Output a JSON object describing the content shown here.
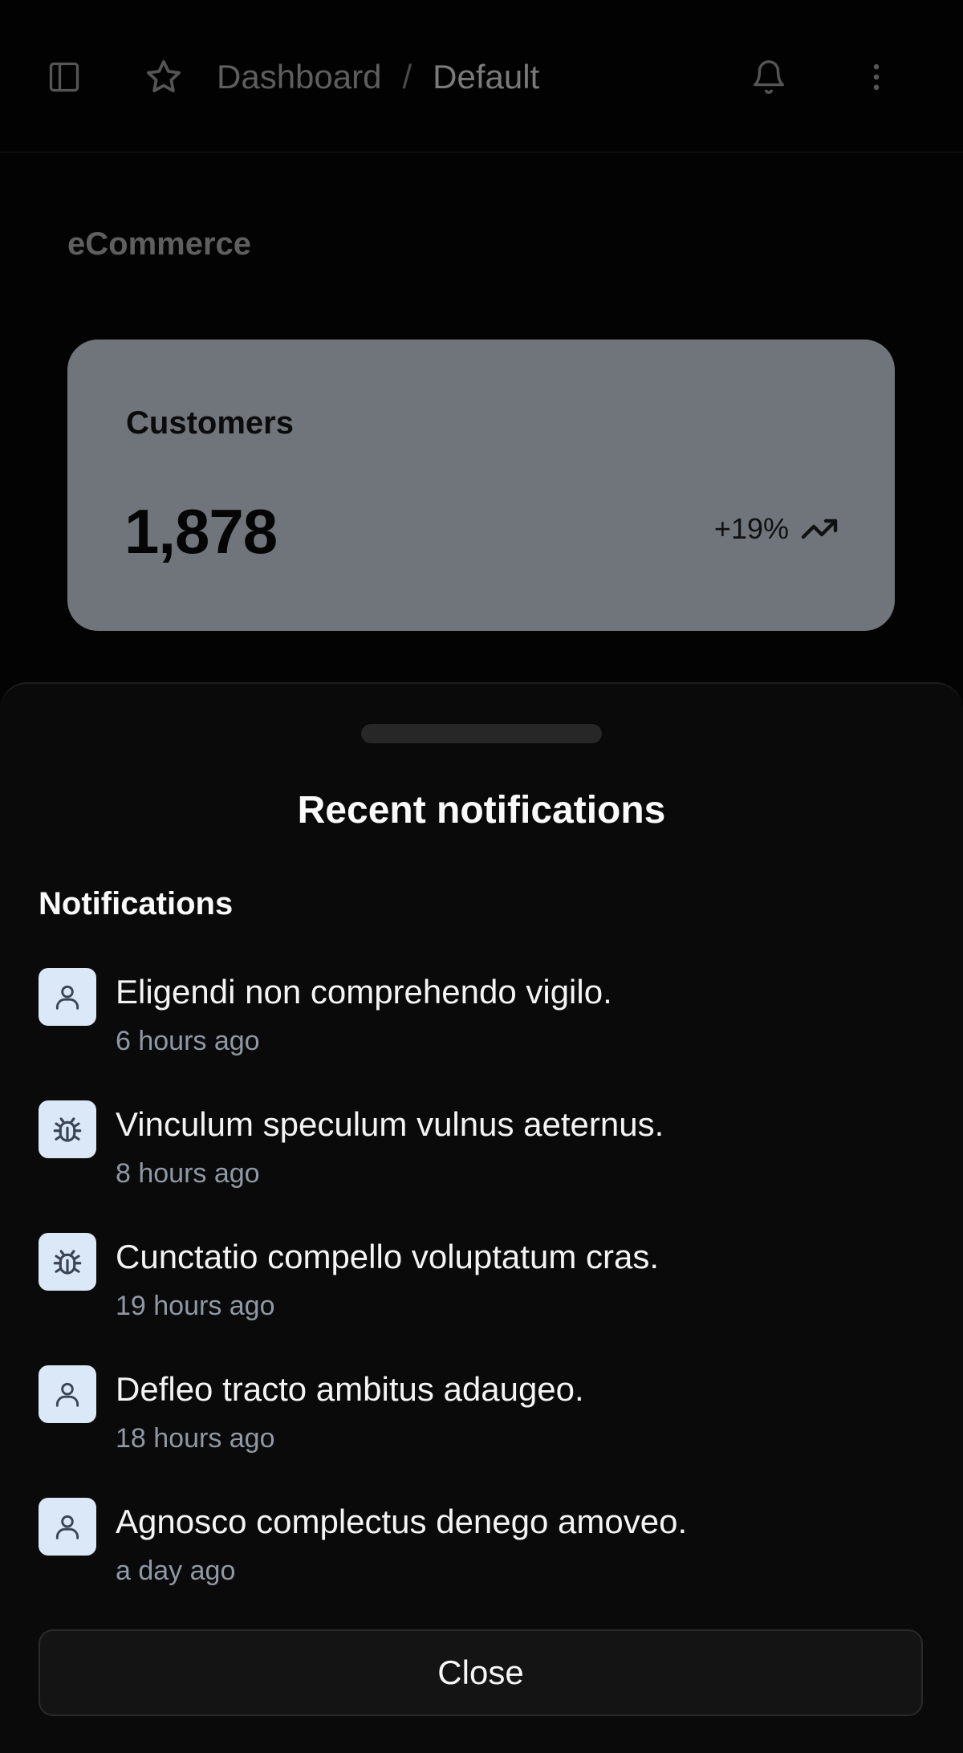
{
  "header": {
    "breadcrumb": [
      "Dashboard",
      "/",
      "Default"
    ]
  },
  "main": {
    "section_title": "eCommerce",
    "card": {
      "title": "Customers",
      "value": "1,878",
      "trend": "+19%"
    }
  },
  "sheet": {
    "title": "Recent notifications",
    "list_title": "Notifications",
    "items": [
      {
        "icon": "user-icon",
        "message": "Eligendi non comprehendo vigilo.",
        "time": "6 hours ago"
      },
      {
        "icon": "bug-icon",
        "message": "Vinculum speculum vulnus aeternus.",
        "time": "8 hours ago"
      },
      {
        "icon": "bug-icon",
        "message": "Cunctatio compello voluptatum cras.",
        "time": "19 hours ago"
      },
      {
        "icon": "user-icon",
        "message": "Defleo tracto ambitus adaugeo.",
        "time": "18 hours ago"
      },
      {
        "icon": "user-icon",
        "message": "Agnosco complectus denego amoveo.",
        "time": "a day ago"
      }
    ],
    "close_label": "Close"
  },
  "colors": {
    "card_bg": "#6f757b",
    "icon_bg": "#dbe8f7",
    "icon_fg": "#3a4452",
    "sheet_bg": "#0a0a0a"
  }
}
